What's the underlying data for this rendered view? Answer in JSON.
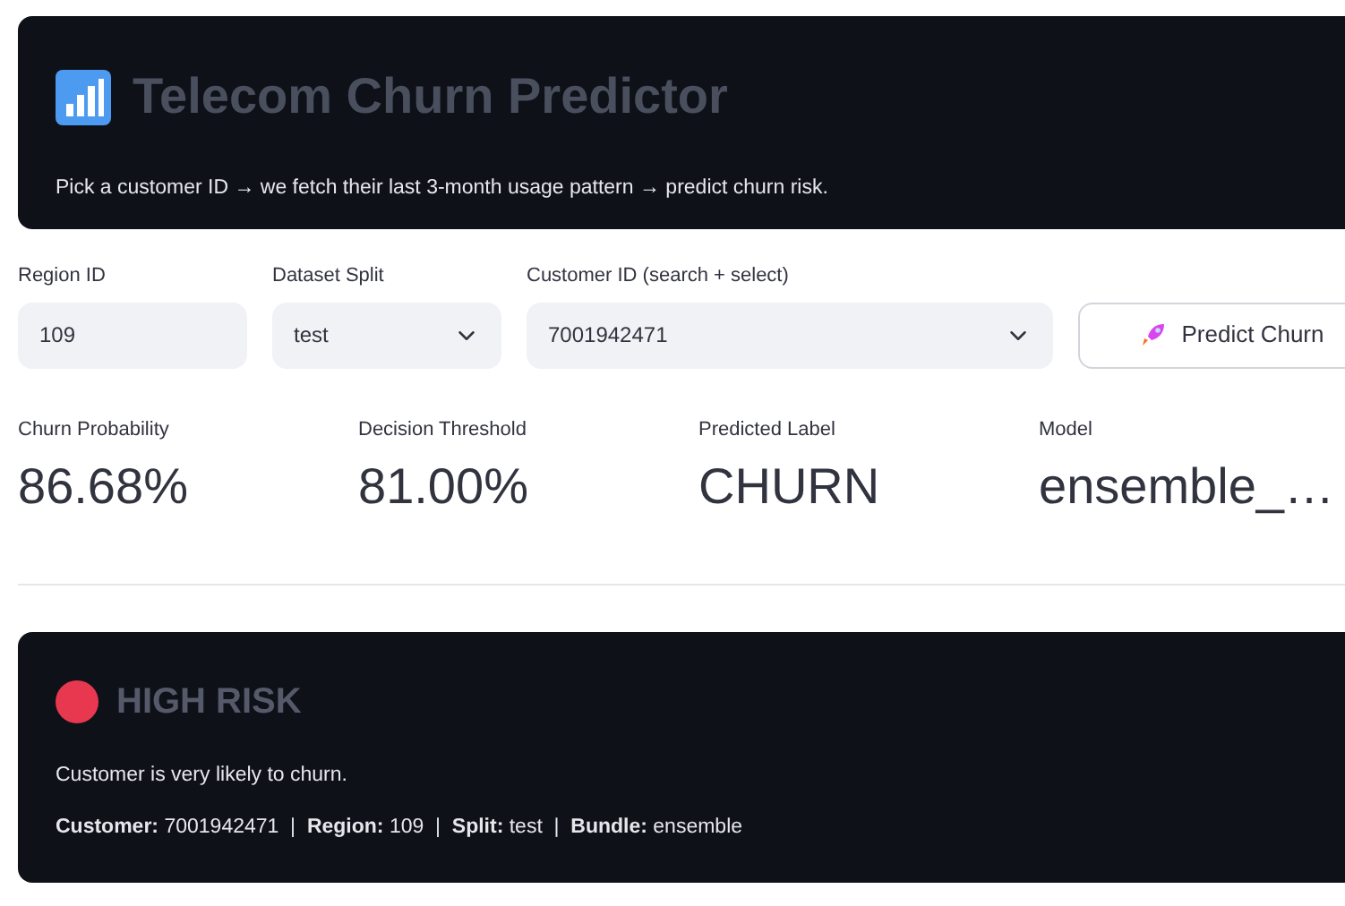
{
  "header": {
    "title": "Telecom Churn Predictor",
    "subtitle": "Pick a customer ID → we fetch their last 3-month usage pattern → predict churn risk."
  },
  "controls": [
    {
      "kind": "input",
      "label": "Region ID",
      "value": "109"
    },
    {
      "kind": "select",
      "label": "Dataset Split",
      "value": "test"
    },
    {
      "kind": "select",
      "label": "Customer ID (search + select)",
      "value": "7001942471"
    },
    {
      "kind": "button",
      "label": "Predict Churn"
    }
  ],
  "metrics": [
    {
      "label": "Churn Probability",
      "value": "86.68%"
    },
    {
      "label": "Decision Threshold",
      "value": "81.00%"
    },
    {
      "label": "Predicted Label",
      "value": "CHURN"
    },
    {
      "label": "Model",
      "value": "ensemble_…"
    }
  ],
  "result": {
    "title": "HIGH RISK",
    "color": "#e8384f",
    "message": "Customer is very likely to churn.",
    "details": "**Customer:** 7001942471  |  **Region:** 109  |  **Split:** test  |  **Bundle:** ensemble"
  }
}
